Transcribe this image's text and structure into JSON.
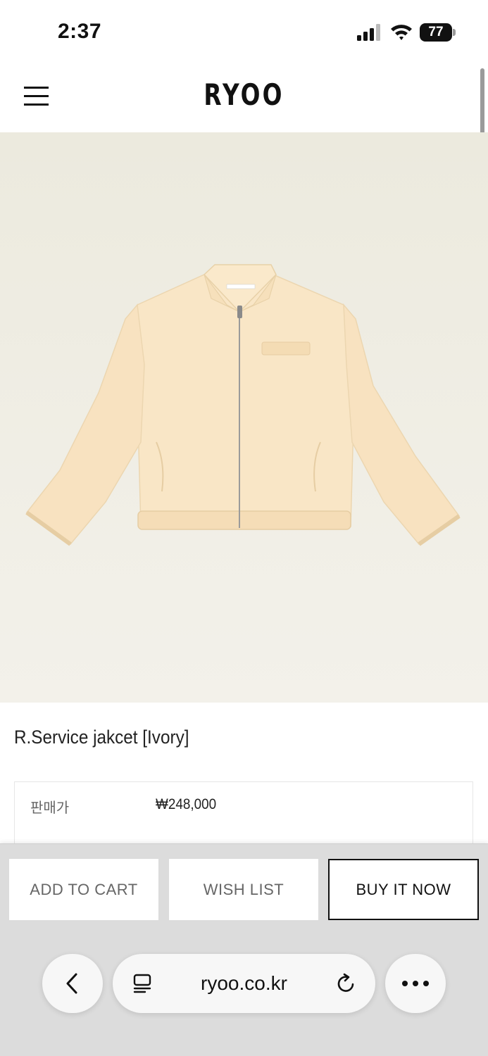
{
  "status": {
    "time": "2:37",
    "battery": "77"
  },
  "header": {
    "logo": "RYOO"
  },
  "product": {
    "name": "R.Service jakcet [Ivory]",
    "price_label": "판매가",
    "price": "₩248,000"
  },
  "actions": {
    "add_to_cart": "ADD TO CART",
    "wish_list": "WISH LIST",
    "buy_now": "BUY IT NOW"
  },
  "browser": {
    "url": "ryoo.co.kr"
  },
  "icons": {
    "menu": "hamburger-menu-icon",
    "back": "chevron-left-icon",
    "reader": "reader-icon",
    "reload": "reload-icon",
    "more": "more-icon"
  }
}
